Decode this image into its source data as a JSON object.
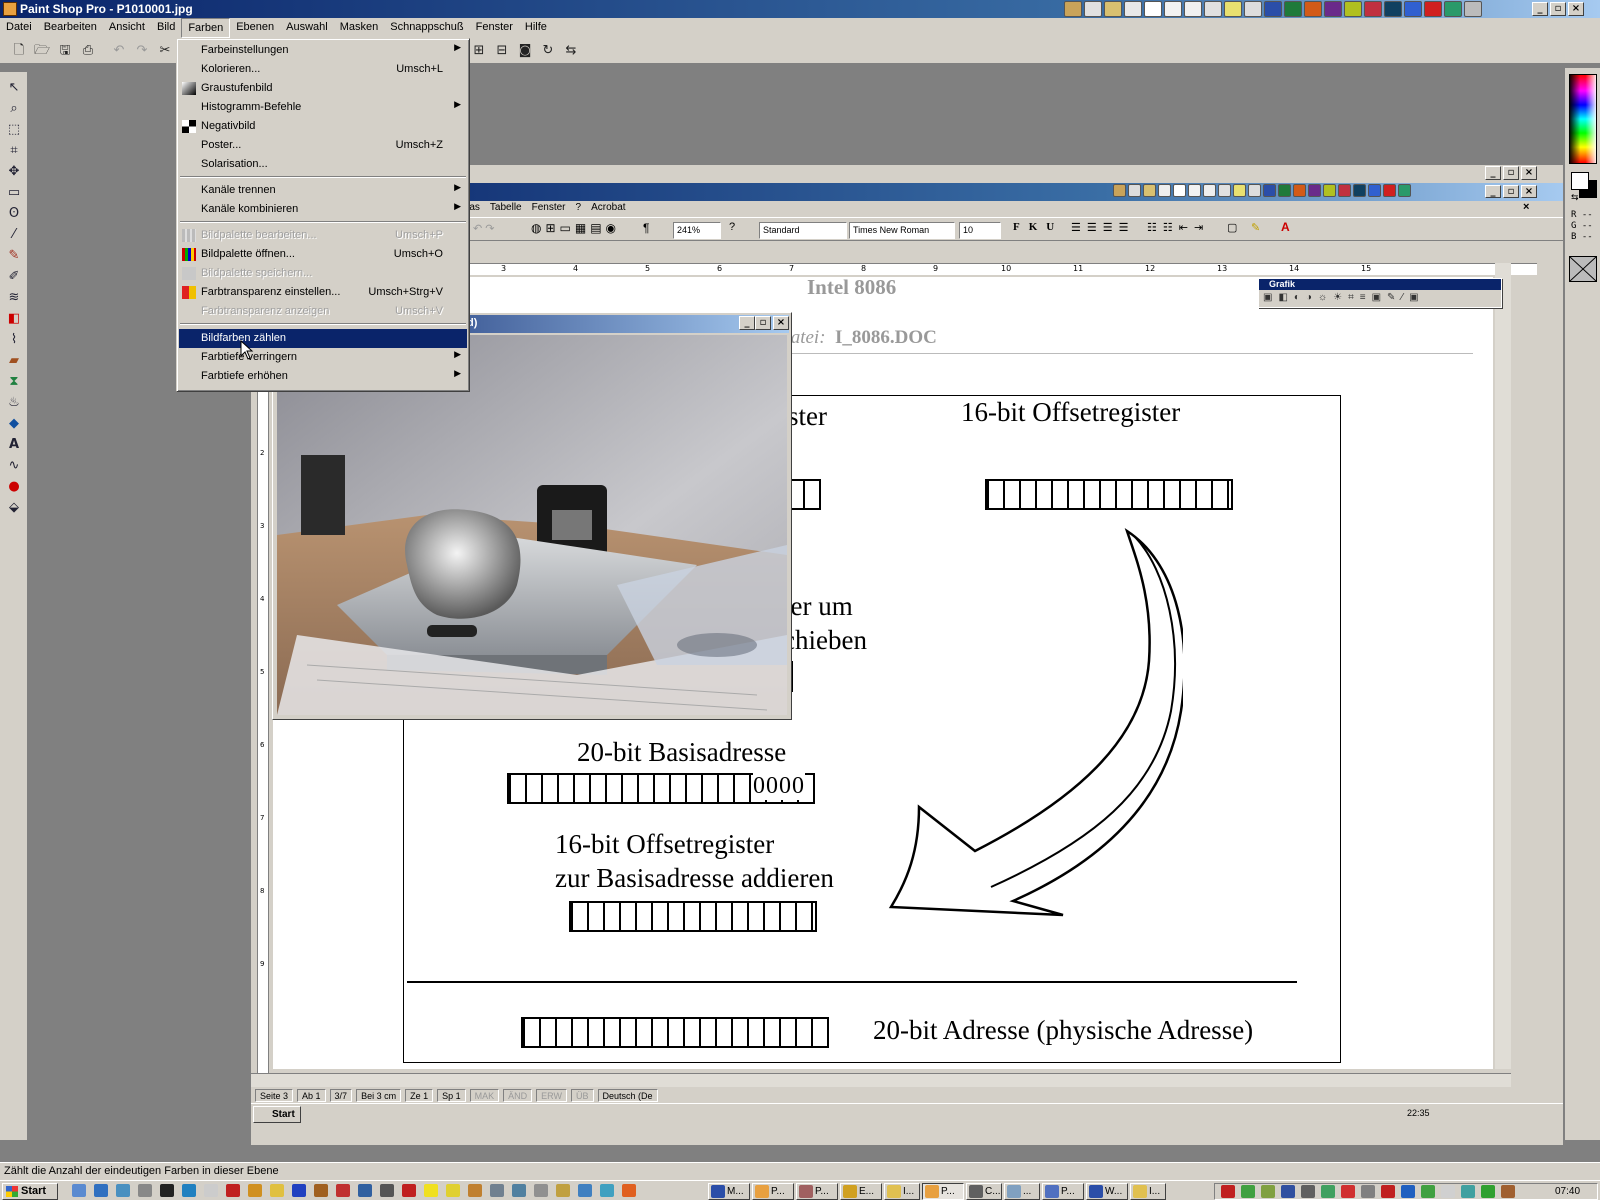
{
  "psp": {
    "title": "Paint Shop Pro - P1010001.jpg",
    "menus": [
      "Datei",
      "Bearbeiten",
      "Ansicht",
      "Bild",
      "Farben",
      "Ebenen",
      "Auswahl",
      "Masken",
      "Schnappschuß",
      "Fenster",
      "Hilfe"
    ],
    "status_text": "Zählt die Anzahl der eindeutigen Farben in dieser Ebene",
    "rgb_readout": [
      "R --",
      "G --",
      "B --"
    ]
  },
  "farben_menu": {
    "items": [
      {
        "label": "Farbeinstellungen",
        "shortcut": "",
        "submenu": true,
        "disabled": false
      },
      {
        "label": "Kolorieren...",
        "shortcut": "Umsch+L",
        "submenu": false,
        "disabled": false
      },
      {
        "label": "Graustufenbild",
        "shortcut": "",
        "submenu": false,
        "disabled": false
      },
      {
        "label": "Histogramm-Befehle",
        "shortcut": "",
        "submenu": true,
        "disabled": false
      },
      {
        "label": "Negativbild",
        "shortcut": "",
        "submenu": false,
        "disabled": false
      },
      {
        "label": "Poster...",
        "shortcut": "Umsch+Z",
        "submenu": false,
        "disabled": false
      },
      {
        "label": "Solarisation...",
        "shortcut": "",
        "submenu": false,
        "disabled": false
      },
      {
        "label": "Kanäle trennen",
        "shortcut": "",
        "submenu": true,
        "disabled": false
      },
      {
        "label": "Kanäle kombinieren",
        "shortcut": "",
        "submenu": true,
        "disabled": false
      },
      {
        "label": "Bildpalette bearbeiten...",
        "shortcut": "Umsch+P",
        "submenu": false,
        "disabled": true
      },
      {
        "label": "Bildpalette öffnen...",
        "shortcut": "Umsch+O",
        "submenu": false,
        "disabled": false
      },
      {
        "label": "Bildpalette speichern...",
        "shortcut": "",
        "submenu": false,
        "disabled": true
      },
      {
        "label": "Farbtransparenz einstellen...",
        "shortcut": "Umsch+Strg+V",
        "submenu": false,
        "disabled": false
      },
      {
        "label": "Farbtransparenz anzeigen",
        "shortcut": "Umsch+V",
        "submenu": false,
        "disabled": true
      },
      {
        "label": "Bildfarben zählen",
        "shortcut": "",
        "submenu": false,
        "disabled": false,
        "highlighted": true
      },
      {
        "label": "Farbtiefe verringern",
        "shortcut": "",
        "submenu": true,
        "disabled": false
      },
      {
        "label": "Farbtiefe erhöhen",
        "shortcut": "",
        "submenu": true,
        "disabled": false
      }
    ]
  },
  "word": {
    "menus": [
      "ras",
      "Tabelle",
      "Fenster",
      "?",
      "Acrobat"
    ],
    "zoom": "241%",
    "style": "Standard",
    "font": "Times New Roman",
    "size": "10",
    "ruler_numbers": [
      "3",
      "4",
      "5",
      "6",
      "7",
      "8",
      "9",
      "10",
      "11",
      "12",
      "13",
      "14",
      "15"
    ],
    "vruler_numbers": [
      "1",
      "2",
      "3",
      "4",
      "5",
      "6",
      "7",
      "8",
      "9"
    ],
    "status": {
      "seite": "Seite 3",
      "ab": "Ab 1",
      "pages": "3/7",
      "bei": "Bei 3 cm",
      "ze": "Ze 1",
      "sp": "Sp 1",
      "mak": "MAK",
      "and": "ÄND",
      "erw": "ERW",
      "ub": "ÜB",
      "lang": "Deutsch (De"
    },
    "clock": "22:35",
    "grafik_title": "Grafik",
    "page": {
      "header_title": "Intel 8086",
      "header_file_label": "Datei:",
      "header_file_name": "I_8086.DOC",
      "seg_reg_partial": "gister",
      "offset_reg": "16-bit Offsetregister",
      "shift_line1": "ter um",
      "shift_line2": "chieben",
      "base_addr": "20-bit Basisadresse",
      "zeros": "0000",
      "offset_add_line1": "16-bit Offsetregister",
      "offset_add_line2": "zur Basisadresse addieren",
      "phys_addr": "20-bit Adresse (physische Adresse)"
    }
  },
  "photo_window": {
    "title_partial": "d)"
  },
  "taskbar": {
    "start": "Start",
    "buttons": [
      "M...",
      "P...",
      "P...",
      "E...",
      "I...",
      "P...",
      "C...",
      "...",
      "P...",
      "W...",
      "I..."
    ],
    "clock": "07:40"
  }
}
